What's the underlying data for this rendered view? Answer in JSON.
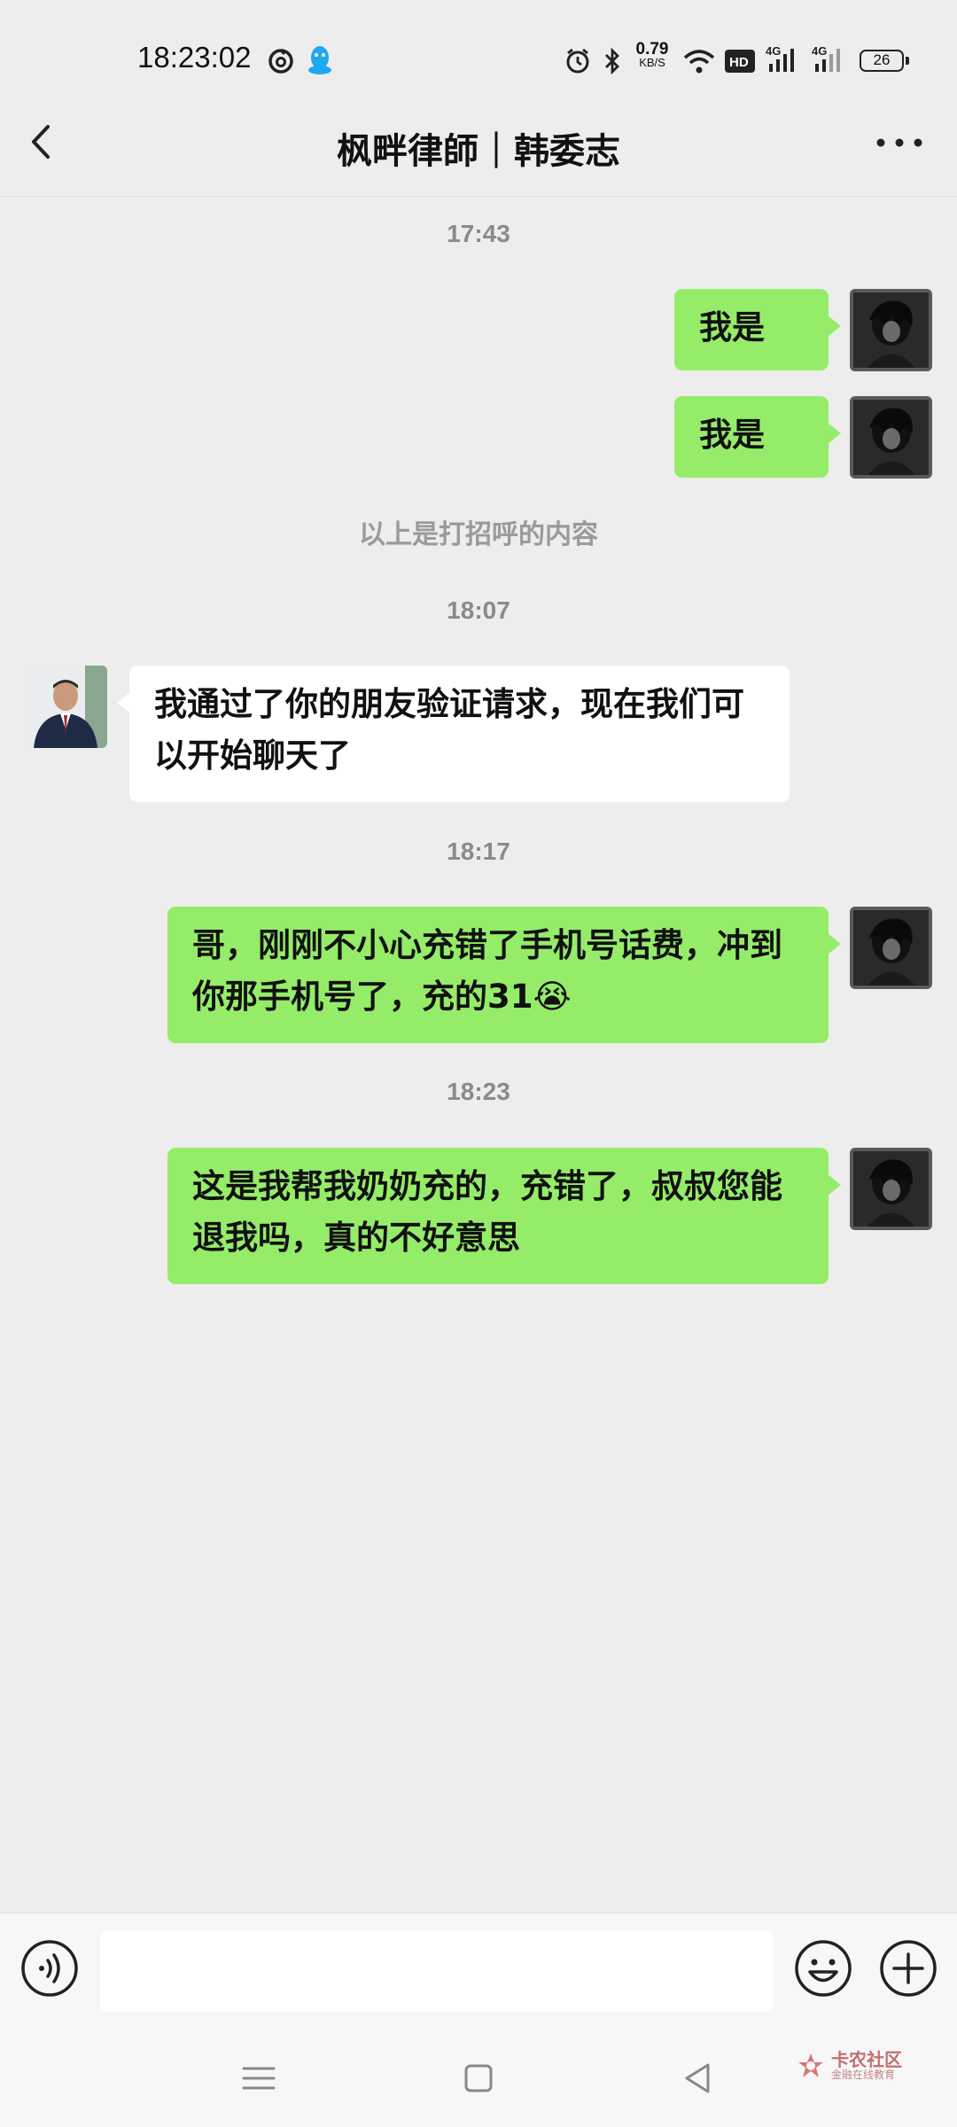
{
  "status_bar": {
    "time": "18:23:02",
    "net_speed_value": "0.79",
    "net_speed_unit": "KB/S",
    "hd_label": "HD",
    "signal_1_label": "4G",
    "signal_2_label": "4G",
    "battery_level": "26",
    "icons": [
      "netease-music-icon",
      "qq-penguin-icon",
      "alarm-icon",
      "bluetooth-icon",
      "wifi-icon",
      "hd-voice-icon",
      "signal-4g-icon",
      "signal-4g-icon",
      "battery-icon"
    ]
  },
  "header": {
    "title": "枫畔律師｜韩委志"
  },
  "messages": {
    "t1": "17:43",
    "m1": "我是",
    "m2": "我是",
    "note": "以上是打招呼的内容",
    "t2": "18:07",
    "m3": "我通过了你的朋友验证请求，现在我们可以开始聊天了",
    "t3": "18:17",
    "m4": "哥，刚刚不小心充错了手机号话费，冲到你那手机号了，充的31😭",
    "t4": "18:23",
    "m5": "这是我帮我奶奶充的，充错了，叔叔您能退我吗，真的不好意思"
  },
  "input": {
    "value": "",
    "placeholder": ""
  },
  "watermark": {
    "title": "卡农社区",
    "subtitle": "金融在线教育"
  },
  "colors": {
    "background": "#ededed",
    "my_bubble": "#95ec69",
    "other_bubble": "#ffffff",
    "timestamp": "#8a8a8a",
    "watermark": "#c46e6e"
  }
}
